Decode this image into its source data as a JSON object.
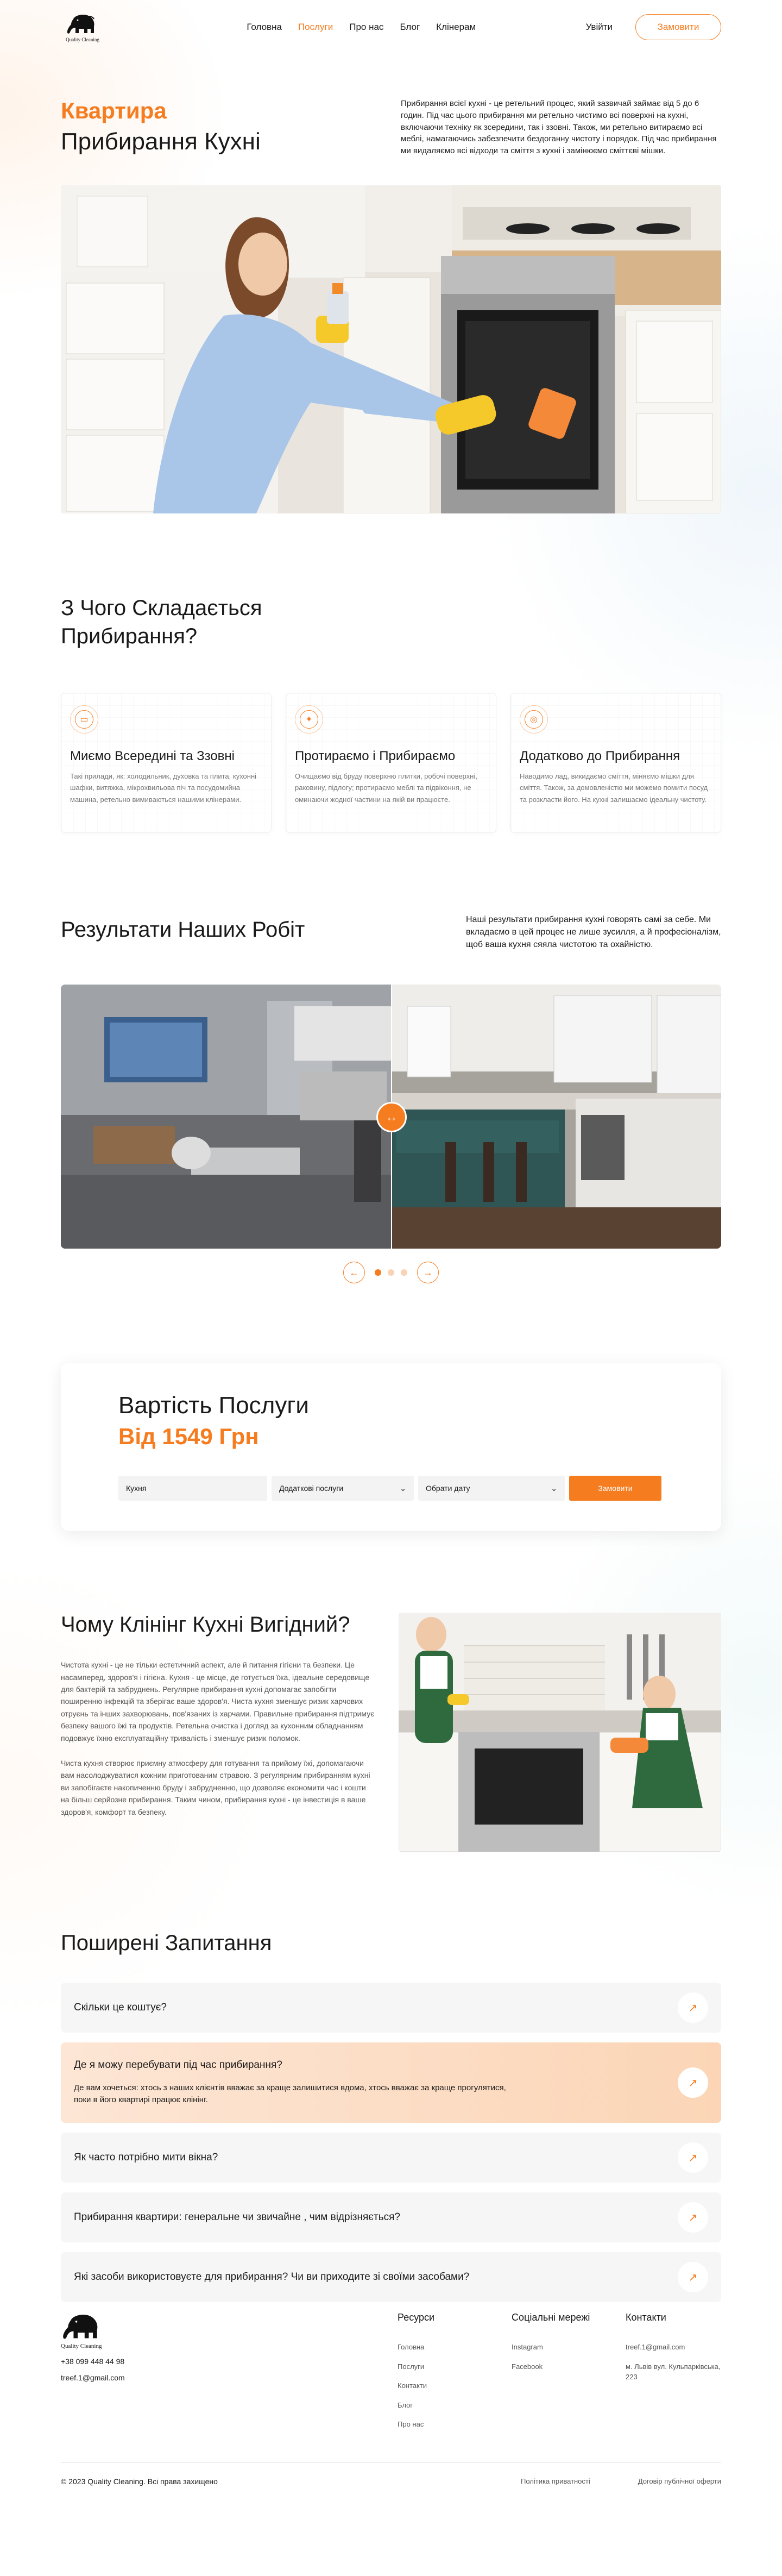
{
  "brand": {
    "name": "Quality Cleaning"
  },
  "nav": {
    "items": [
      {
        "label": "Головна",
        "active": false
      },
      {
        "label": "Послуги",
        "active": true
      },
      {
        "label": "Про нас",
        "active": false
      },
      {
        "label": "Блог",
        "active": false
      },
      {
        "label": "Клінерам",
        "active": false
      }
    ],
    "login": "Увійти",
    "order": "Замовити"
  },
  "hero": {
    "accent": "Квартира",
    "title": "Прибирання Кухні",
    "description": "Прибирання всієї кухні - це ретельний процес, який зазвичай займає від 5 до 6 годин. Під час цього прибирання ми ретельно чистимо всі поверхні на кухні, включаючи техніку як зсередини, так і ззовні. Також, ми ретельно витираємо всі меблі, намагаючись забезпечити бездоганну чистоту і порядок. Під час прибирання ми видаляємо всі відходи та сміття з кухні і замінюємо сміттєві мішки."
  },
  "compose": {
    "title_line1": "З Чого Складається",
    "title_line2": "Прибирання?",
    "cards": [
      {
        "title": "Миємо Всередині та Ззовні",
        "text": "Такі прилади, як: холодильник, духовка та плита, кухонні шафки, витяжка, мікрохвильова піч та посудомийна машина, ретельно вимиваються нашими клінерами."
      },
      {
        "title": "Протираємо і Прибираємо",
        "text": "Очищаємо від бруду поверхню плитки, робочі поверхні, раковину, підлогу; протираємо меблі та підвіконня, не оминаючи жодної частини на якій ви працюєте."
      },
      {
        "title": "Додатково до Прибирання",
        "text": "Наводимо лад, викидаємо сміття, міняємо мішки для сміття. Також, за домовленістю ми можемо помити посуд та розкласти його. На кухні залишаємо ідеальну чистоту."
      }
    ]
  },
  "results": {
    "title": "Результати Наших Робіт",
    "description": "Наші результати прибирання кухні говорять самі за себе. Ми вкладаємо в цей процес не лише зусилля, а й професіоналізм, щоб ваша кухня сяяла чистотою та охайністю.",
    "slide_count": 3,
    "active_slide": 1
  },
  "price": {
    "title": "Вартість Послуги",
    "amount": "Від 1549 Грн",
    "field_service": "Кухня",
    "field_extra": "Додаткові послуги",
    "field_date": "Обрати дату",
    "submit": "Замовити"
  },
  "why": {
    "title": "Чому Клінінг Кухні Вигідний?",
    "paragraph1": "Чистота кухні - це не тільки естетичний аспект, але й питання гігієни та безпеки. Це насамперед, здоров'я і гігієна. Кухня - це місце, де готується їжа, ідеальне середовище для бактерій та забруднень. Регулярне прибирання кухні допомагає запобігти поширенню інфекцій та зберігає ваше здоров'я. Чиста кухня зменшує ризик харчових отруєнь та інших захворювань, пов'язаних із харчами. Правильне прибирання підтримує безпеку вашого їжі та продуктів. Ретельна очистка і догляд за кухонним обладнанням подовжує їхню експлуатаційну тривалість і зменшує ризик поломок.",
    "paragraph2": "Чиста кухня створює приємну атмосферу для готування та прийому їжі, допомагаючи вам насолоджуватися кожним приготованим стравою. З регулярним прибиранням кухні ви запобігаєте накопиченню бруду і забрудненню, що дозволяє економити час і кошти на більш серйозне прибирання. Таким чином, прибирання кухні - це інвестиція в ваше здоров'я, комфорт та безпеку."
  },
  "faq": {
    "title": "Поширені Запитання",
    "items": [
      {
        "q": "Скільки це коштує?",
        "a": "",
        "open": false
      },
      {
        "q": "Де я можу перебувати під час прибирання?",
        "a": "Де вам хочеться: хтось з наших клієнтів вважає за краще залишитися вдома, хтось вважає за краще прогулятися, поки в його квартирі працює клінінг.",
        "open": true
      },
      {
        "q": "Як часто потрібно мити вікна?",
        "a": "",
        "open": false
      },
      {
        "q": "Прибирання квартири: генеральне чи звичайне , чим відрізняється?",
        "a": "",
        "open": false
      },
      {
        "q": "Які засоби використовуєте для прибирання? Чи ви приходите зі своїми засобами?",
        "a": "",
        "open": false
      }
    ]
  },
  "footer": {
    "phone": "+38 099 448 44 98",
    "email": "treef.1@gmail.com",
    "resources": {
      "title": "Ресурси",
      "links": [
        "Головна",
        "Послуги",
        "Контакти",
        "Блог",
        "Про нас"
      ]
    },
    "social": {
      "title": "Соціальні мережі",
      "links": [
        "Instagram",
        "Facebook"
      ]
    },
    "contacts": {
      "title": "Контакти",
      "email": "treef.1@gmail.com",
      "address": "м. Львів вул. Кульпарківська, 223"
    },
    "copyright": "© 2023 Quality Cleaning. Всі права захищено",
    "privacy": "Політика приватності",
    "offer": "Договір публічної оферти"
  },
  "colors": {
    "accent": "#f57c1f",
    "accent_light": "#fbd5b6"
  }
}
